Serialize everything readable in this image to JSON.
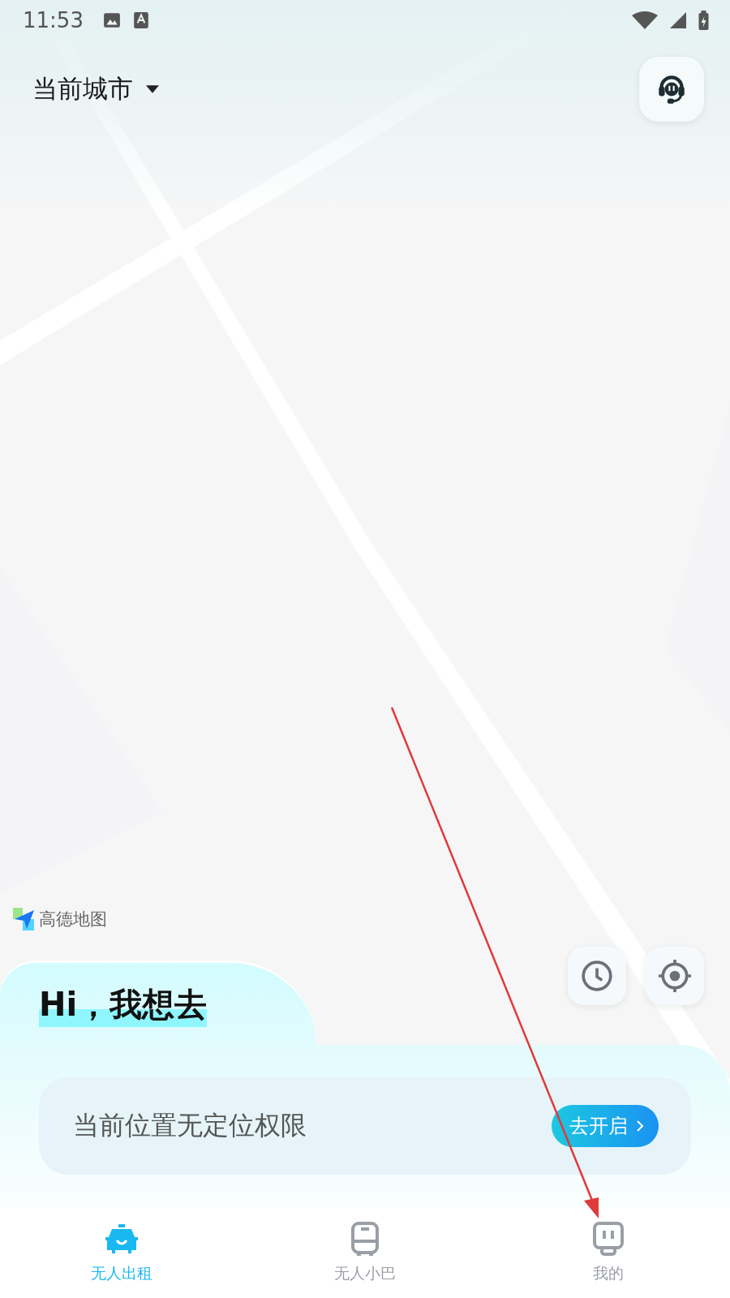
{
  "status_bar": {
    "time": "11:53"
  },
  "header": {
    "city": "当前城市"
  },
  "map": {
    "attribution": "高德地图"
  },
  "panel": {
    "greeting": "Hi，我想去",
    "notice": "当前位置无定位权限",
    "action": "去开启"
  },
  "tabs": [
    {
      "label": "无人出租",
      "kind": "taxi",
      "selected": true
    },
    {
      "label": "无人小巴",
      "kind": "bus",
      "selected": false
    },
    {
      "label": "我的",
      "kind": "me",
      "selected": false
    }
  ]
}
